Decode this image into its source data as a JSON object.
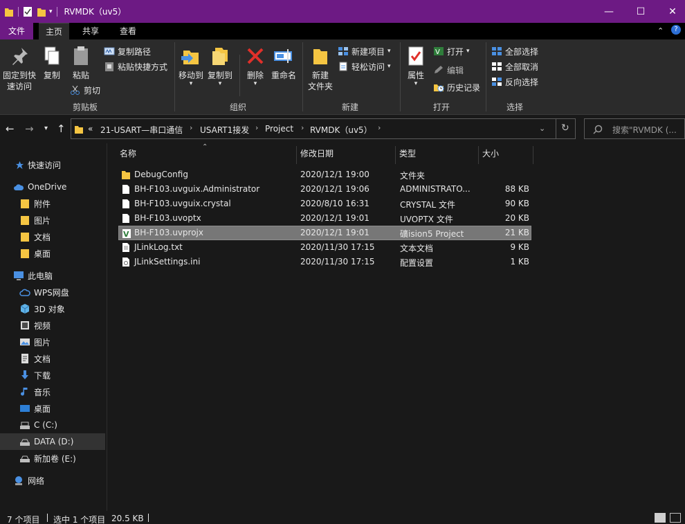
{
  "window": {
    "title": "RVMDK（uv5）",
    "minimize": "—",
    "maximize": "☐",
    "close": "✕"
  },
  "ribbon_tabs": [
    "文件",
    "主页",
    "共享",
    "查看"
  ],
  "ribbon": {
    "clipboard": {
      "pin_label_1": "固定到快",
      "pin_label_2": "速访问",
      "copy": "复制",
      "paste": "粘贴",
      "copy_path": "复制路径",
      "paste_shortcut": "粘贴快捷方式",
      "cut": "剪切",
      "group": "剪贴板"
    },
    "organize": {
      "move_to": "移动到",
      "copy_to": "复制到",
      "delete": "删除",
      "rename": "重命名",
      "group": "组织"
    },
    "new": {
      "new_folder_1": "新建",
      "new_folder_2": "文件夹",
      "new_item": "新建项目",
      "easy_access": "轻松访问",
      "group": "新建"
    },
    "open": {
      "properties": "属性",
      "open": "打开",
      "edit": "编辑",
      "history": "历史记录",
      "group": "打开"
    },
    "select": {
      "select_all": "全部选择",
      "select_none": "全部取消",
      "invert": "反向选择",
      "group": "选择"
    }
  },
  "address": {
    "overflow": "«",
    "crumbs": [
      "21-USART—串口通信",
      "USART1接发",
      "Project",
      "RVMDK（uv5）"
    ],
    "search_placeholder": "搜索\"RVMDK (..."
  },
  "sidebar": {
    "items": [
      {
        "label": "快速访问",
        "icon": "star-icon"
      },
      {
        "label": "OneDrive",
        "icon": "cloud-icon"
      },
      {
        "label": "附件",
        "icon": "folder-icon"
      },
      {
        "label": "图片",
        "icon": "folder-icon"
      },
      {
        "label": "文档",
        "icon": "folder-icon"
      },
      {
        "label": "桌面",
        "icon": "folder-icon"
      },
      {
        "label": "此电脑",
        "icon": "computer-icon"
      },
      {
        "label": "WPS网盘",
        "icon": "cloud-icon"
      },
      {
        "label": "3D 对象",
        "icon": "cube-icon"
      },
      {
        "label": "视频",
        "icon": "video-icon"
      },
      {
        "label": "图片",
        "icon": "picture-icon"
      },
      {
        "label": "文档",
        "icon": "document-icon"
      },
      {
        "label": "下载",
        "icon": "download-icon"
      },
      {
        "label": "音乐",
        "icon": "music-icon"
      },
      {
        "label": "桌面",
        "icon": "desktop-icon"
      },
      {
        "label": "C (C:)",
        "icon": "drive-icon"
      },
      {
        "label": "DATA (D:)",
        "icon": "drive-icon"
      },
      {
        "label": "新加卷 (E:)",
        "icon": "drive-icon"
      },
      {
        "label": "网络",
        "icon": "network-icon"
      }
    ]
  },
  "columns": {
    "name": "名称",
    "modified": "修改日期",
    "type": "类型",
    "size": "大小"
  },
  "files": [
    {
      "name": "DebugConfig",
      "modified": "2020/12/1 19:00",
      "type": "文件夹",
      "size": "",
      "icon": "folder-icon"
    },
    {
      "name": "BH-F103.uvguix.Administrator",
      "modified": "2020/12/1 19:06",
      "type": "ADMINISTRATO...",
      "size": "88 KB",
      "icon": "file-icon"
    },
    {
      "name": "BH-F103.uvguix.crystal",
      "modified": "2020/8/10 16:31",
      "type": "CRYSTAL 文件",
      "size": "90 KB",
      "icon": "file-icon"
    },
    {
      "name": "BH-F103.uvoptx",
      "modified": "2020/12/1 19:01",
      "type": "UVOPTX 文件",
      "size": "20 KB",
      "icon": "file-icon"
    },
    {
      "name": "BH-F103.uvprojx",
      "modified": "2020/12/1 19:01",
      "type": "礦ision5 Project",
      "size": "21 KB",
      "icon": "keil-project-icon"
    },
    {
      "name": "JLinkLog.txt",
      "modified": "2020/11/30 17:15",
      "type": "文本文档",
      "size": "9 KB",
      "icon": "text-file-icon"
    },
    {
      "name": "JLinkSettings.ini",
      "modified": "2020/11/30 17:15",
      "type": "配置设置",
      "size": "1 KB",
      "icon": "settings-file-icon"
    }
  ],
  "status": {
    "count": "7 个项目",
    "selected": "选中 1 个项目",
    "size": "20.5 KB"
  },
  "colors": {
    "accent": "#6d1a84",
    "background": "#191919",
    "ribbon": "#2b2b2b",
    "selection": "#777777",
    "folder": "#f5c542"
  }
}
